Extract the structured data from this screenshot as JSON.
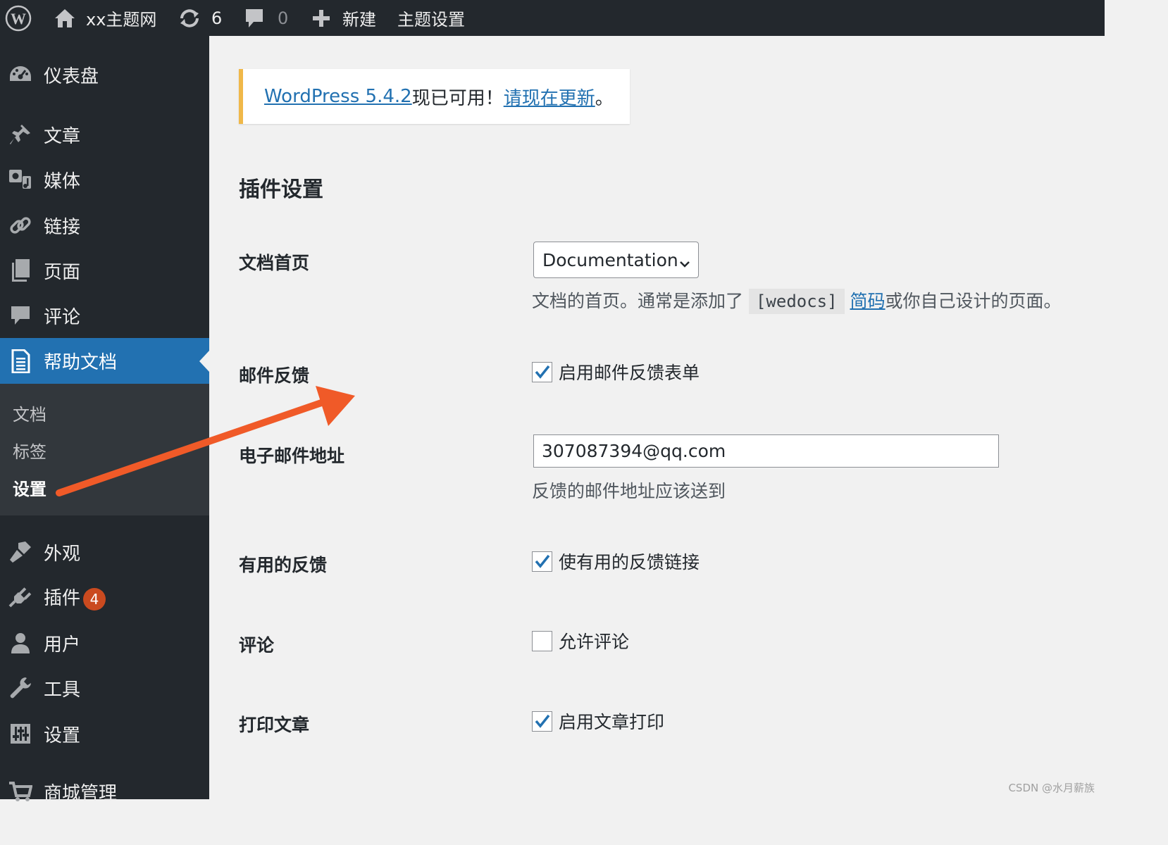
{
  "adminbar": {
    "site_name": "xx主题网",
    "updates_count": "6",
    "comments_count": "0",
    "new_label": "新建",
    "theme_settings_label": "主题设置"
  },
  "sidebar": {
    "items": [
      {
        "name": "dashboard",
        "label": "仪表盘",
        "icon": "dashboard-icon"
      },
      {
        "name": "posts",
        "label": "文章",
        "icon": "pushpin-icon"
      },
      {
        "name": "media",
        "label": "媒体",
        "icon": "media-icon"
      },
      {
        "name": "links",
        "label": "链接",
        "icon": "link-icon"
      },
      {
        "name": "pages",
        "label": "页面",
        "icon": "page-icon"
      },
      {
        "name": "comments",
        "label": "评论",
        "icon": "comment-icon"
      },
      {
        "name": "docs",
        "label": "帮助文档",
        "icon": "document-icon"
      },
      {
        "name": "appearance",
        "label": "外观",
        "icon": "brush-icon"
      },
      {
        "name": "plugins",
        "label": "插件",
        "icon": "plug-icon",
        "badge": "4"
      },
      {
        "name": "users",
        "label": "用户",
        "icon": "user-icon"
      },
      {
        "name": "tools",
        "label": "工具",
        "icon": "wrench-icon"
      },
      {
        "name": "settings",
        "label": "设置",
        "icon": "sliders-icon"
      },
      {
        "name": "shop",
        "label": "商城管理",
        "icon": "cart-icon"
      }
    ],
    "submenu": [
      "文档",
      "标签",
      "设置"
    ]
  },
  "notice": {
    "link1": "WordPress 5.4.2",
    "text": "现已可用！",
    "link2": "请现在更新",
    "end": "。"
  },
  "page": {
    "title": "插件设置"
  },
  "settings": {
    "doc_home": {
      "label": "文档首页",
      "select_value": "Documentation",
      "desc_pre": "文档的首页。通常是添加了",
      "code": "[wedocs]",
      "desc_link": "简码",
      "desc_post": "或你自己设计的页面。"
    },
    "email_feedback": {
      "label": "邮件反馈",
      "checkbox_label": "启用邮件反馈表单",
      "checked": true
    },
    "email_address": {
      "label": "电子邮件地址",
      "value": "307087394@qq.com",
      "desc": "反馈的邮件地址应该送到"
    },
    "helpful_feedback": {
      "label": "有用的反馈",
      "checkbox_label": "使有用的反馈链接",
      "checked": true
    },
    "comments": {
      "label": "评论",
      "checkbox_label": "允许评论",
      "checked": false
    },
    "print": {
      "label": "打印文章",
      "checkbox_label": "启用文章打印",
      "checked": true
    }
  },
  "colors": {
    "admin_bg": "#23282d",
    "accent": "#2271b1",
    "annotation_arrow": "#f05a28",
    "notice_border": "#f0b849"
  },
  "watermark": "CSDN @水月薪族"
}
